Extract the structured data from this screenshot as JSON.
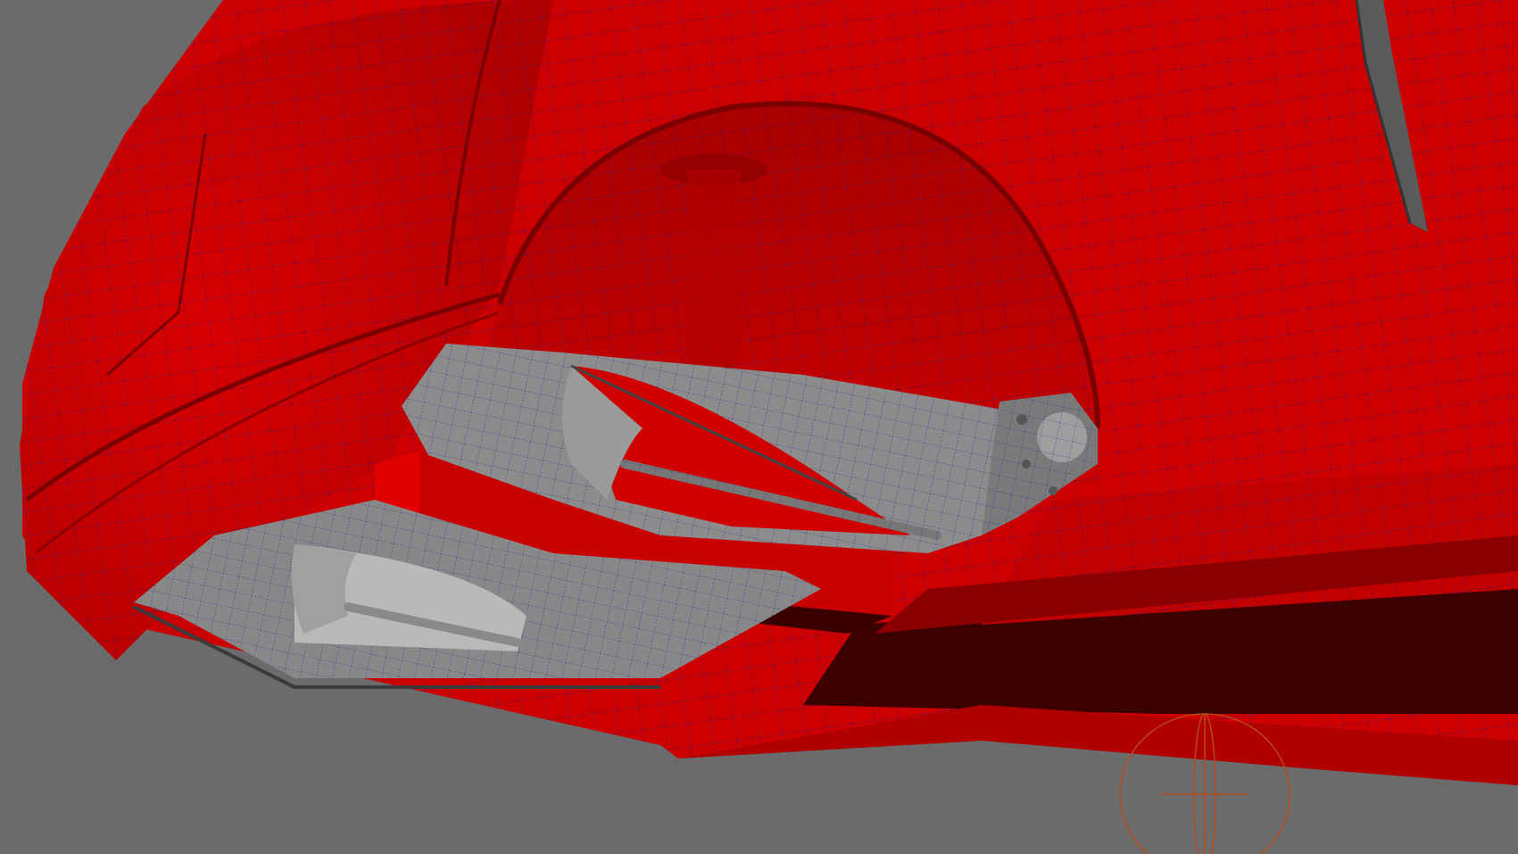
{
  "viewport": {
    "background_color": "#6b6b6b",
    "body_color": "#d60000",
    "body_shadow_color": "#8a0000",
    "body_dark_color": "#3a0000",
    "suspension_color": "#8c8c8c",
    "suspension_dark_color": "#555555",
    "wireframe_color": "#1a1a8c",
    "gizmo_color": "#b84a1a"
  }
}
